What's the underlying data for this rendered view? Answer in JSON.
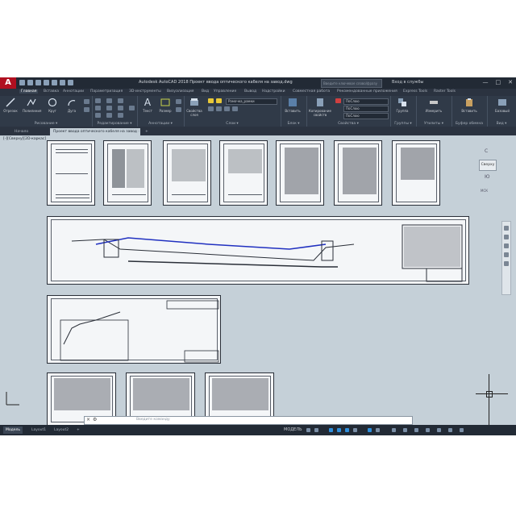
{
  "app": {
    "logo_letter": "A",
    "title": "Autodesk AutoCAD 2018   Проект ввода оптического кабеля на завод.dwg",
    "search_placeholder": "Введите ключевое слово/фразу",
    "login_label": "Вход в службы",
    "window_buttons": [
      "—",
      "□",
      "✕"
    ]
  },
  "ribbon_tabs": [
    "Главная",
    "Вставка",
    "Аннотации",
    "Параметризация",
    "3D-инструменты",
    "Визуализация",
    "Вид",
    "Управление",
    "Вывод",
    "Надстройки",
    "Совместная работа",
    "Рекомендованные приложения",
    "Express Tools",
    "Raster Tools"
  ],
  "ribbon_tools": {
    "draw": [
      "Отрезок",
      "Полилиния",
      "Круг",
      "Дуга"
    ],
    "annotation": [
      "Текст",
      "Размер"
    ],
    "layer_properties": "Свойства слоя",
    "insert": "Вставить",
    "copy_properties": "Копирование свойств",
    "group": "Группа",
    "measure": "Измерить",
    "paste": "Вставить",
    "base": "Базовый",
    "layer_combo": "Рамочка_рамки",
    "prop_bylayer_1": "ПоСлою",
    "prop_bylayer_2": "ПоСлою",
    "prop_bylayer_3": "ПоСлою"
  },
  "ribbon_panels": [
    "Рисование ▾",
    "Редактирование ▾",
    "Аннотации ▾",
    "Слои ▾",
    "Блок ▾",
    "Свойства ▾",
    "Группы ▾",
    "Утилиты ▾",
    "Буфер обмена",
    "Вид ▾"
  ],
  "document_tabs": [
    "Начало",
    "Проект ввода оптического кабеля на завод"
  ],
  "viewport_label": "[-][Сверху][2D-каркас]",
  "viewcube": {
    "top_label": "С",
    "face_label": "Сверху",
    "bottom_label": "Ю",
    "wcs_label": "МСК"
  },
  "command_line": {
    "placeholder": "Введите команду"
  },
  "layout_tabs": [
    "Модель",
    "Layout1",
    "Layout2",
    "+"
  ],
  "status": {
    "model_label": "МОДЕЛЬ"
  }
}
